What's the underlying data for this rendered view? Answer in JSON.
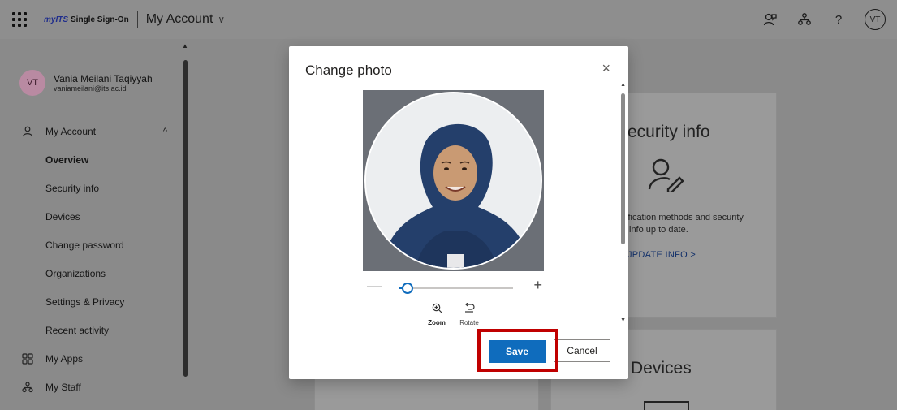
{
  "topbar": {
    "brand_my": "my",
    "brand_its": "ITS",
    "brand_rest": "Single Sign-On",
    "app_title": "My Account",
    "app_title_chevron": "∨",
    "icons": [
      "feedback-icon",
      "organization-icon",
      "help-icon"
    ],
    "help_glyph": "?",
    "avatar_initials": "VT"
  },
  "user": {
    "initials": "VT",
    "name": "Vania Meilani Taqiyyah",
    "email": "vaniameilani@its.ac.id"
  },
  "nav": {
    "section": "My Account",
    "section_chevron": "^",
    "items": [
      "Overview",
      "Security info",
      "Devices",
      "Change password",
      "Organizations",
      "Settings & Privacy",
      "Recent activity"
    ],
    "active": "Overview",
    "apps": "My Apps",
    "staff": "My Staff"
  },
  "cards": {
    "security": {
      "title": "ecurity info",
      "desc_line1": "ification methods and security",
      "desc_line2": "info up to date.",
      "link": "JPDATE INFO >"
    },
    "devices": {
      "title": "Devices"
    }
  },
  "modal": {
    "title": "Change photo",
    "close": "×",
    "zoom_minus": "—",
    "zoom_plus": "+",
    "zoom_level": 0.07,
    "tools": {
      "zoom_label": "Zoom",
      "rotate_label": "Rotate"
    },
    "save_label": "Save",
    "cancel_label": "Cancel"
  },
  "colors": {
    "accent": "#0f6cbd",
    "highlight": "#c00000",
    "overlay_bg": "#8a8a8a"
  }
}
